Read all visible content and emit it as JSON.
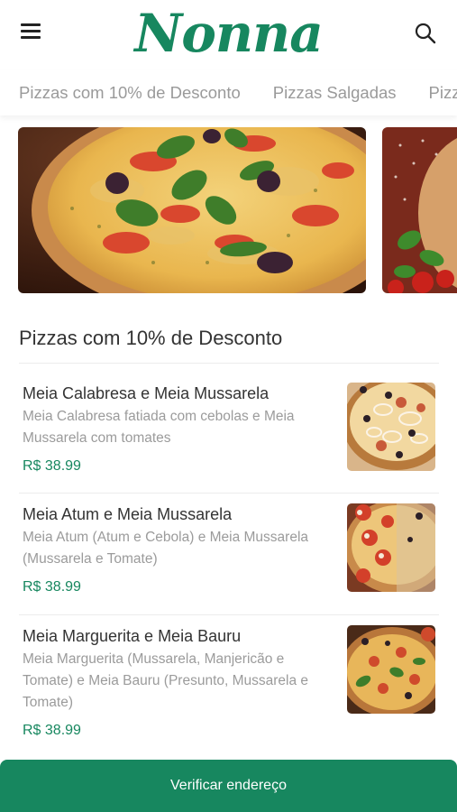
{
  "header": {
    "logo": "Nonna",
    "menu_icon": "hamburger-menu-icon",
    "search_icon": "search-icon"
  },
  "tabs": [
    {
      "label": "Pizzas com 10% de Desconto"
    },
    {
      "label": "Pizzas Salgadas"
    },
    {
      "label": "Pizzas Doces"
    }
  ],
  "section": {
    "title": "Pizzas com 10% de Desconto"
  },
  "products": [
    {
      "name": "Meia Calabresa e Meia Mussarela",
      "description": "Meia Calabresa fatiada com cebolas e Meia Mussarela com tomates",
      "price": "R$ 38.99"
    },
    {
      "name": "Meia Atum e Meia Mussarela",
      "description": "Meia Atum (Atum e Cebola) e Meia Mussarela (Mussarela e Tomate)",
      "price": "R$ 38.99"
    },
    {
      "name": "Meia Marguerita e Meia Bauru",
      "description": "Meia Marguerita (Mussarela, Manjericão e Tomate) e Meia Bauru (Presunto, Mussarela e Tomate)",
      "price": "R$ 38.99"
    }
  ],
  "footer": {
    "button_label": "Verificar endereço"
  },
  "colors": {
    "accent": "#17875f",
    "text": "#333333",
    "muted": "#9b9b9b"
  }
}
